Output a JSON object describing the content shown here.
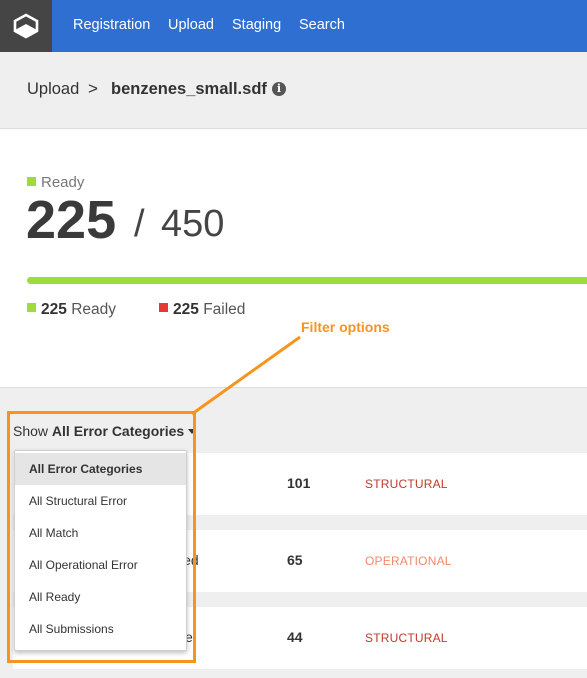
{
  "nav": {
    "logo": "cube-logo-icon",
    "items": [
      "Registration",
      "Upload",
      "Staging",
      "Search"
    ]
  },
  "breadcrumb": {
    "section": "Upload",
    "separator": ">",
    "file": "benzenes_small.sdf",
    "info_icon": "i"
  },
  "status": {
    "label": "Ready",
    "ready_count": "225",
    "separator": "/",
    "total": "450",
    "progress_fraction": 0.5,
    "legend": {
      "ready_count": "225",
      "ready_label": "Ready",
      "failed_count": "225",
      "failed_label": "Failed"
    }
  },
  "filter": {
    "prefix": "Show",
    "selected": "All Error Categories",
    "options": [
      "All Error Categories",
      "All Structural Error",
      "All Match",
      "All Operational Error",
      "All Ready",
      "All Submissions"
    ]
  },
  "rows": [
    {
      "name": "",
      "count": "101",
      "category": "STRUCTURAL"
    },
    {
      "name": "wed",
      "count": "65",
      "category": "OPERATIONAL"
    },
    {
      "name": "e",
      "count": "44",
      "category": "STRUCTURAL"
    }
  ],
  "annotation": {
    "label": "Filter options"
  },
  "colors": {
    "nav_bg": "#2e6fd1",
    "ready_green": "#9ddc3b",
    "failed_red": "#e53935",
    "annotation_orange": "#f7941d"
  }
}
